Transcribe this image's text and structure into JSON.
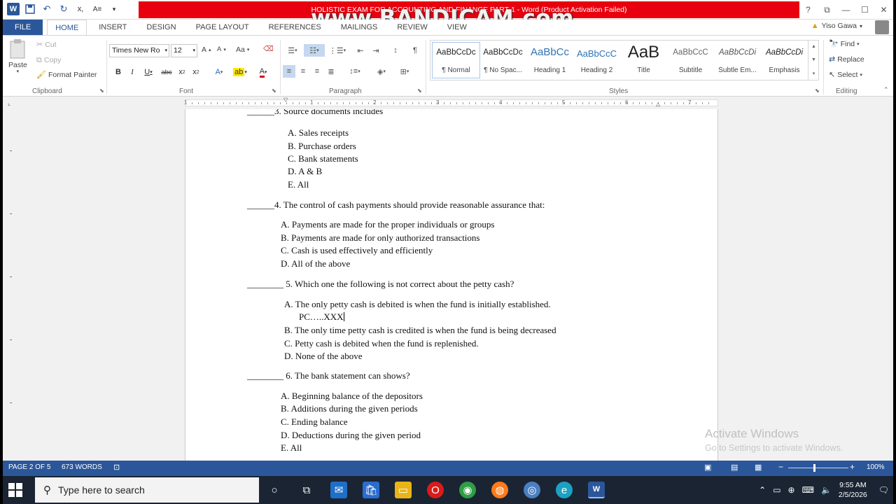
{
  "window": {
    "title": "HOLISTIC EXAM FOR ACCOUNTING AND FINANCE PART-1 - Word (Product Activation Failed)",
    "watermark": "www.BANDICAM.com",
    "user": "Yiso Gawa"
  },
  "tabs": [
    "FILE",
    "HOME",
    "INSERT",
    "DESIGN",
    "PAGE LAYOUT",
    "REFERENCES",
    "MAILINGS",
    "REVIEW",
    "VIEW"
  ],
  "ribbon": {
    "clipboard": {
      "paste": "Paste",
      "cut": "Cut",
      "copy": "Copy",
      "format_painter": "Format Painter",
      "label": "Clipboard"
    },
    "font": {
      "name": "Times New Ro",
      "size": "12",
      "label": "Font"
    },
    "paragraph": {
      "label": "Paragraph"
    },
    "styles": {
      "label": "Styles",
      "items": [
        {
          "preview": "AaBbCcDc",
          "name": "¶ Normal"
        },
        {
          "preview": "AaBbCcDc",
          "name": "¶ No Spac..."
        },
        {
          "preview": "AaBbCc",
          "name": "Heading 1"
        },
        {
          "preview": "AaBbCcC",
          "name": "Heading 2"
        },
        {
          "preview": "AaB",
          "name": "Title"
        },
        {
          "preview": "AaBbCcC",
          "name": "Subtitle"
        },
        {
          "preview": "AaBbCcDi",
          "name": "Subtle Em..."
        },
        {
          "preview": "AaBbCcDi",
          "name": "Emphasis"
        }
      ]
    },
    "editing": {
      "find": "Find",
      "replace": "Replace",
      "select": "Select",
      "label": "Editing"
    }
  },
  "ruler": [
    "1",
    "1",
    "2",
    "3",
    "4",
    "5",
    "6",
    "7"
  ],
  "document": {
    "q3": {
      "blank": "______",
      "text": "3. Source documents includes"
    },
    "q3_options": [
      "A.  Sales receipts",
      "B.  Purchase orders",
      "C.  Bank statements",
      "D.  A & B",
      "E.  All"
    ],
    "q4": {
      "blank": "______",
      "text": "4. The control of cash payments should provide reasonable assurance that:"
    },
    "q4_options": [
      "A.  Payments are made for the proper individuals or groups",
      "B.  Payments are made for only authorized transactions",
      "C.  Cash is used effectively and efficiently",
      "D.  All of the above"
    ],
    "q5": {
      "blank": "________",
      "text": "5. Which one the following is not correct about the petty cash?"
    },
    "q5_options": [
      "A.  The only petty cash is debited is when the fund is initially established.",
      "PC…..XXX",
      "B.  The only time petty cash is credited is when the fund is being decreased",
      "C.  Petty cash is debited when the fund is replenished.",
      "D.  None of the above"
    ],
    "q6": {
      "blank": "________",
      "text": "6. The bank statement can shows?"
    },
    "q6_options": [
      "A.   Beginning balance of the depositors",
      "B.  Additions during the given periods",
      "C.  Ending balance",
      "D.  Deductions during the given period",
      "E.  All"
    ]
  },
  "activation": {
    "line1": "Activate Windows",
    "line2": "Go to Settings to activate Windows."
  },
  "status": {
    "page": "PAGE 2 OF 5",
    "words": "673 WORDS",
    "zoom": "100%"
  },
  "taskbar": {
    "search_placeholder": "Type here to search",
    "time": "9:55 AM",
    "date": "2/5/2026"
  }
}
